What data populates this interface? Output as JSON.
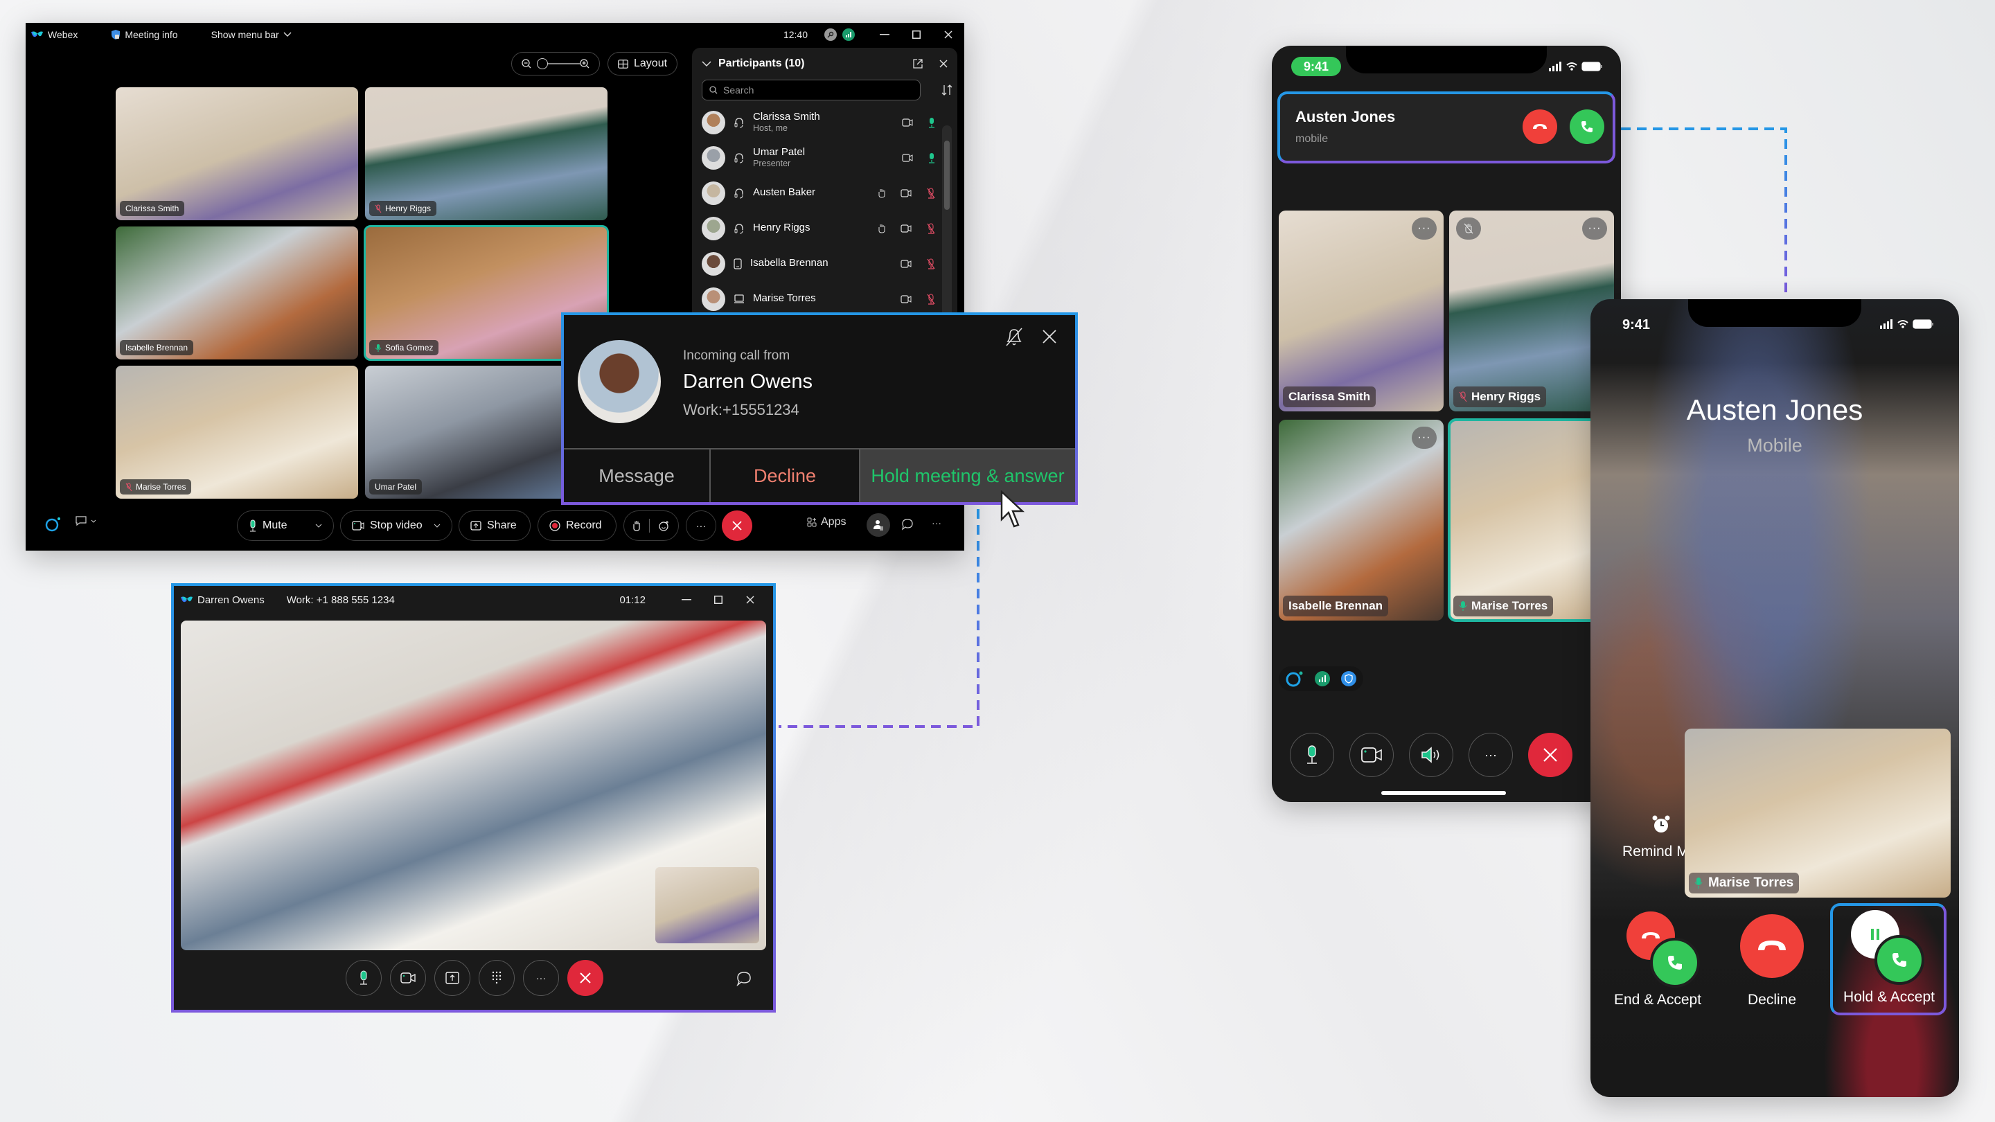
{
  "meeting_window": {
    "app_name": "Webex",
    "meeting_info_label": "Meeting info",
    "show_menu_bar_label": "Show menu bar",
    "clock": "12:40",
    "layout_label": "Layout",
    "grid": [
      {
        "name": "Clarissa Smith",
        "mic": "none",
        "active": false
      },
      {
        "name": "Henry Riggs",
        "mic": "muted",
        "active": false
      },
      {
        "name": "Isabelle Brennan",
        "mic": "none",
        "active": false
      },
      {
        "name": "Sofia Gomez",
        "mic": "on",
        "active": true
      },
      {
        "name": "Marise Torres",
        "mic": "muted",
        "active": false
      },
      {
        "name": "Umar Patel",
        "mic": "none",
        "active": false
      }
    ],
    "participants_panel": {
      "title": "Participants (10)",
      "search_placeholder": "Search",
      "rows": [
        {
          "name": "Clarissa Smith",
          "subtitle": "Host, me",
          "device": "headset",
          "hand": false,
          "mic": "on"
        },
        {
          "name": "Umar Patel",
          "subtitle": "Presenter",
          "device": "headset",
          "hand": false,
          "mic": "on"
        },
        {
          "name": "Austen Baker",
          "subtitle": "",
          "device": "headset",
          "hand": true,
          "mic": "muted"
        },
        {
          "name": "Henry Riggs",
          "subtitle": "",
          "device": "headset",
          "hand": true,
          "mic": "muted"
        },
        {
          "name": "Isabella Brennan",
          "subtitle": "",
          "device": "phone",
          "hand": false,
          "mic": "muted"
        },
        {
          "name": "Marise Torres",
          "subtitle": "",
          "device": "laptop",
          "hand": false,
          "mic": "muted"
        }
      ]
    },
    "toolbar": {
      "mute_label": "Mute",
      "stop_video_label": "Stop video",
      "share_label": "Share",
      "record_label": "Record",
      "apps_label": "Apps"
    }
  },
  "incoming_call": {
    "heading": "Incoming call from",
    "caller_name": "Darren Owens",
    "caller_number": "Work:+15551234",
    "message_label": "Message",
    "decline_label": "Decline",
    "hold_answer_label": "Hold meeting & answer"
  },
  "call_window": {
    "caller_name": "Darren Owens",
    "caller_number": "Work: +1 888 555 1234",
    "duration": "01:12"
  },
  "phone_meeting": {
    "status_time": "9:41",
    "incoming_banner": {
      "name": "Austen Jones",
      "subtitle": "mobile"
    },
    "tiles": [
      {
        "name": "Clarissa Smith",
        "mic": "none",
        "active": false
      },
      {
        "name": "Henry Riggs",
        "mic": "muted",
        "active": false
      },
      {
        "name": "Isabelle Brennan",
        "mic": "none",
        "active": false
      },
      {
        "name": "Marise Torres",
        "mic": "on",
        "active": true
      }
    ]
  },
  "phone_incoming": {
    "status_time": "9:41",
    "caller_name": "Austen Jones",
    "caller_subtitle": "Mobile",
    "remind_label": "Remind M",
    "pip_name": "Marise Torres",
    "end_accept_label": "End & Accept",
    "decline_label": "Decline",
    "hold_accept_label": "Hold & Accept"
  },
  "colors": {
    "accent_blue": "#2597e6",
    "accent_purple": "#7c59dc",
    "decline_red": "#e0283b",
    "accept_green": "#34c759",
    "active_teal": "#1fb5a0",
    "hold_answer_green": "#1fc56a",
    "decline_text": "#f08070"
  }
}
